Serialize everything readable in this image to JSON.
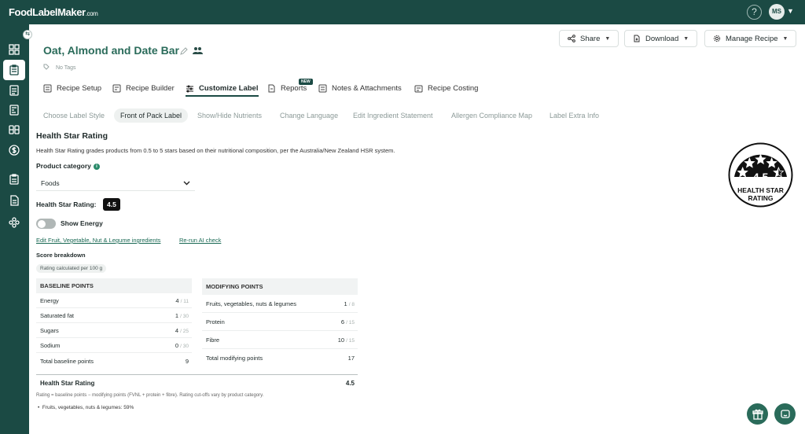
{
  "app": {
    "logo_main": "FoodLabelMaker",
    "logo_domain": ".com",
    "help_glyph": "?",
    "user_initials": "MS",
    "brand_color": "#1b4a44",
    "accent_color": "#2a6b5a"
  },
  "sidebar": {
    "collapse_glyph": "⇆",
    "items": [
      {
        "icon": "dashboard-grid-icon"
      },
      {
        "icon": "recipe-clipboard-icon",
        "active": true
      },
      {
        "icon": "checklist-icon"
      },
      {
        "icon": "nutrition-label-icon"
      },
      {
        "icon": "ingredients-icon"
      },
      {
        "icon": "costing-dollar-icon"
      },
      {
        "icon": "clipboard-list-icon"
      },
      {
        "icon": "document-icon"
      },
      {
        "icon": "integrations-icon"
      }
    ]
  },
  "header": {
    "recipe_title": "Oat, Almond and Date Bar",
    "no_tags": "No Tags",
    "share": "Share",
    "download": "Download",
    "manage_recipe": "Manage Recipe"
  },
  "tabs": [
    {
      "label": "Recipe Setup",
      "icon": "recipe-setup-icon"
    },
    {
      "label": "Recipe Builder",
      "icon": "recipe-builder-icon"
    },
    {
      "label": "Customize Label",
      "icon": "sliders-icon",
      "active": true
    },
    {
      "label": "Reports",
      "icon": "reports-icon"
    },
    {
      "label": "Notes & Attachments",
      "icon": "notes-icon"
    },
    {
      "label": "Recipe Costing",
      "icon": "costing-icon"
    }
  ],
  "reports_badge": "NEW",
  "subtabs": [
    {
      "label": "Choose Label Style"
    },
    {
      "label": "Front of Pack Label",
      "active": true
    },
    {
      "label": "Show/Hide Nutrients"
    },
    {
      "label": "Change Language"
    },
    {
      "label": "Edit Ingredient Statement"
    },
    {
      "label": "Allergen Compliance Map"
    },
    {
      "label": "Label Extra Info"
    }
  ],
  "hsr": {
    "title": "Health Star Rating",
    "description": "Health Star Rating grades products from 0.5 to 5 stars based on their nutritional composition, per the Australia/New Zealand HSR system.",
    "product_category_label": "Product category",
    "info_glyph": "i",
    "product_category_value": "Foods",
    "rating_label": "Health Star Rating:",
    "rating_value": "4.5",
    "stars": 4.5,
    "show_energy_label": "Show Energy",
    "show_energy_on": false,
    "edit_fvnl_link": "Edit Fruit, Vegetable, Nut & Legume ingredients",
    "rerun_ai_link": "Re-run AI check",
    "score_breakdown": "Score breakdown",
    "rating_basis": "Rating calculated per 100 g",
    "baseline": {
      "header": "BASELINE POINTS",
      "rows": [
        {
          "label": "Energy",
          "value": "4",
          "max": "/ 11"
        },
        {
          "label": "Saturated fat",
          "value": "1",
          "max": "/ 30"
        },
        {
          "label": "Sugars",
          "value": "4",
          "max": "/ 25"
        },
        {
          "label": "Sodium",
          "value": "0",
          "max": "/ 30"
        }
      ],
      "total_label": "Total baseline points",
      "total_value": "9"
    },
    "modifying": {
      "header": "MODIFYING POINTS",
      "rows": [
        {
          "label": "Fruits, vegetables, nuts & legumes",
          "value": "1",
          "max": "/ 8"
        },
        {
          "label": "Protein",
          "value": "6",
          "max": "/ 15"
        },
        {
          "label": "Fibre",
          "value": "10",
          "max": "/ 15"
        }
      ],
      "total_label": "Total modifying points",
      "total_value": "17"
    },
    "final_label": "Health Star Rating",
    "final_value": "4.5",
    "formula_note": "Rating = baseline points − modifying points (FVNL + protein + fibre). Rating cut-offs vary by product category.",
    "fvnl_note": "Fruits, vegetables, nuts & legumes: 59%",
    "badge_number": "4.5",
    "badge_line1": "HEALTH STAR",
    "badge_line2": "RATING"
  },
  "fabs": {
    "gift_icon": "gift-icon",
    "chat_icon": "chat-icon"
  }
}
